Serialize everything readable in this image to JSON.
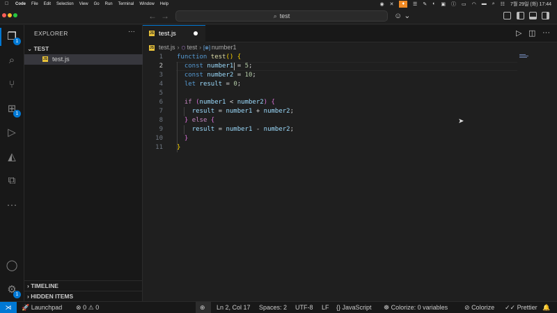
{
  "menubar": {
    "app": "Code",
    "items": [
      "File",
      "Edit",
      "Selection",
      "View",
      "Go",
      "Run",
      "Terminal",
      "Window",
      "Help"
    ],
    "clock": "7월 29일 (화) 17:44"
  },
  "titlebar": {
    "search_text": "test"
  },
  "activity": {
    "explorer_badge": "1",
    "extensions_badge": "1",
    "settings_badge": "1"
  },
  "sidebar": {
    "title": "EXPLORER",
    "folder": "TEST",
    "file": "test.js",
    "timeline": "TIMELINE",
    "hidden": "HIDDEN ITEMS"
  },
  "editor": {
    "tab_label": "test.js",
    "breadcrumb": [
      "test.js",
      "test",
      "number1"
    ],
    "line_numbers": [
      "1",
      "2",
      "3",
      "4",
      "5",
      "6",
      "7",
      "8",
      "9",
      "10",
      "11"
    ],
    "current_line": 2
  },
  "statusbar": {
    "launchpad": "Launchpad",
    "errors": "0",
    "warnings": "0",
    "position": "Ln 2, Col 17",
    "spaces": "Spaces: 2",
    "encoding": "UTF-8",
    "eol": "LF",
    "language": "JavaScript",
    "colorize_vars": "Colorize: 0 variables",
    "colorize": "Colorize",
    "prettier": "Prettier"
  },
  "colors": {
    "accent": "#0078d4",
    "editor_bg": "#1f1f1f",
    "sidebar_bg": "#181818"
  }
}
